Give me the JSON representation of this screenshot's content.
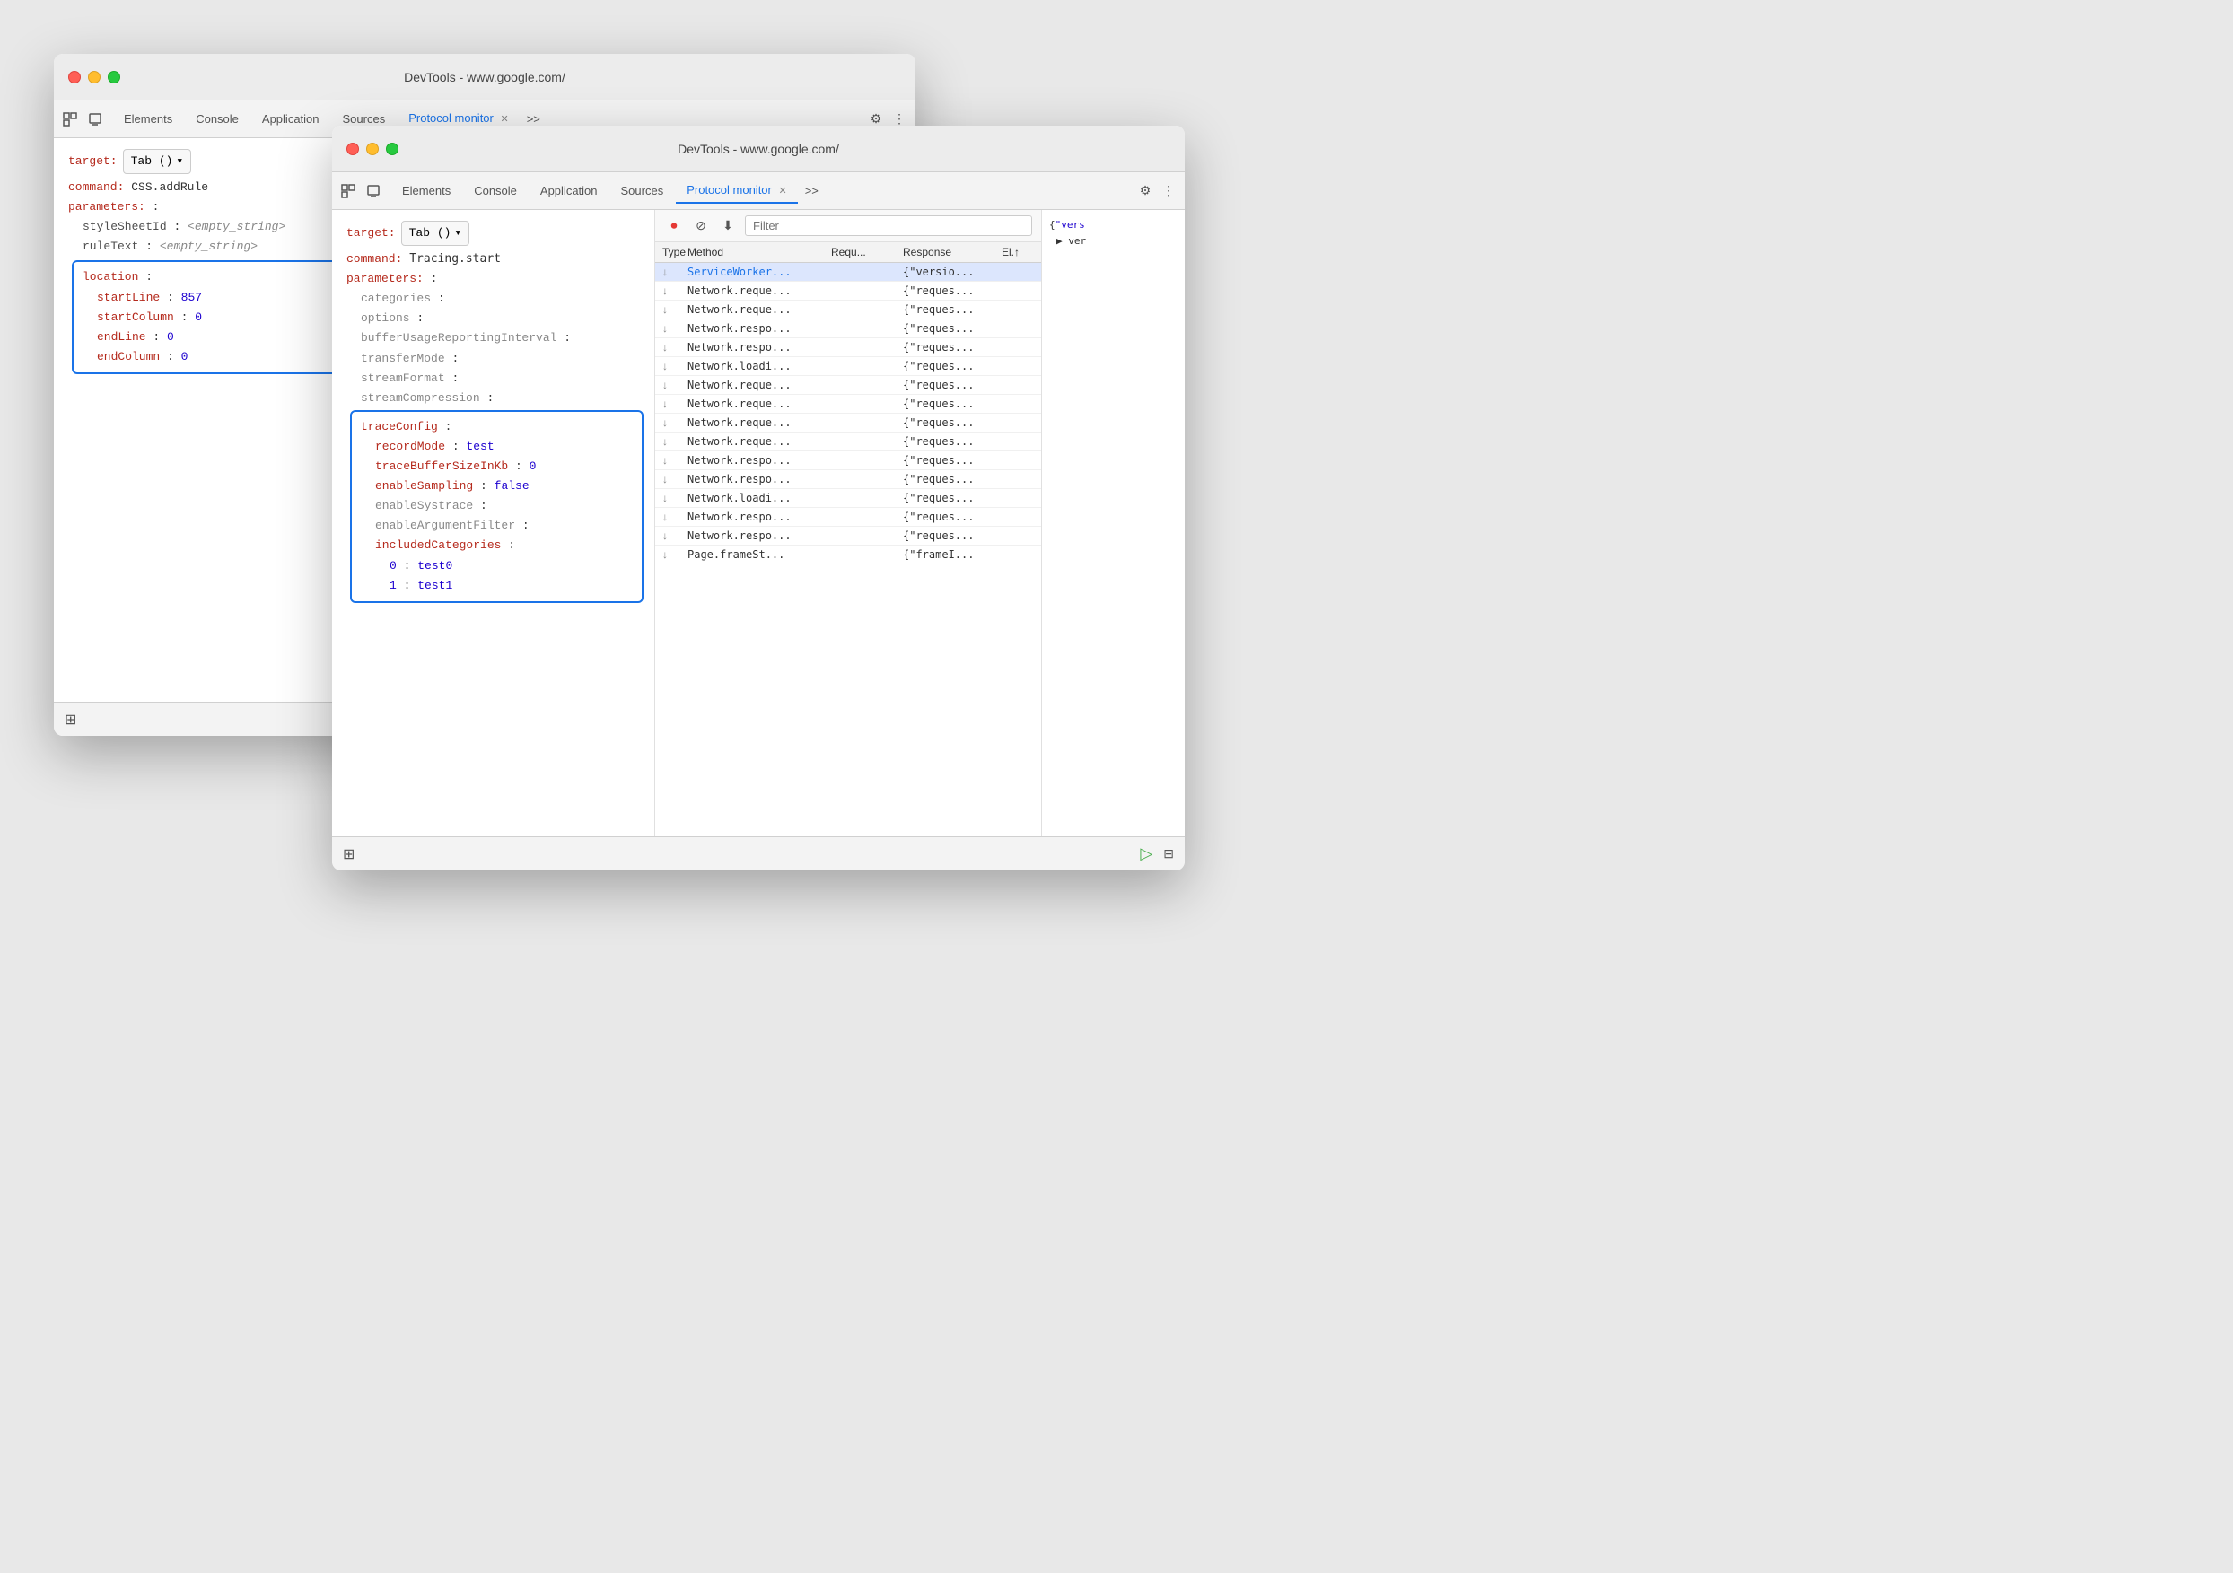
{
  "background_window": {
    "title": "DevTools - www.google.com/",
    "tabs": [
      "Elements",
      "Console",
      "Application",
      "Sources",
      "Protocol monitor"
    ],
    "active_tab": "Protocol monitor",
    "target_label": "target:",
    "target_value": "Tab ()",
    "command_label": "command:",
    "command_value": "CSS.addRule",
    "parameters_label": "parameters:",
    "params": [
      {
        "key": "styleSheetId",
        "value": "<empty_string>",
        "indent": 2
      },
      {
        "key": "ruleText",
        "value": "<empty_string>",
        "indent": 2
      }
    ],
    "location_label": "location",
    "location_params": [
      {
        "key": "startLine",
        "value": "857",
        "indent": 3
      },
      {
        "key": "startColumn",
        "value": "0",
        "indent": 3
      },
      {
        "key": "endLine",
        "value": "0",
        "indent": 3
      },
      {
        "key": "endColumn",
        "value": "0",
        "indent": 3
      }
    ]
  },
  "foreground_window": {
    "title": "DevTools - www.google.com/",
    "tabs": [
      "Elements",
      "Console",
      "Application",
      "Sources",
      "Protocol monitor"
    ],
    "active_tab": "Protocol monitor",
    "target_label": "target:",
    "target_value": "Tab ()",
    "command_label": "command:",
    "command_value": "Tracing.start",
    "parameters_label": "parameters:",
    "params_plain": [
      {
        "key": "categories",
        "indent": 2
      },
      {
        "key": "options",
        "indent": 2
      },
      {
        "key": "bufferUsageReportingInterval",
        "indent": 2
      },
      {
        "key": "transferMode",
        "indent": 2
      },
      {
        "key": "streamFormat",
        "indent": 2
      },
      {
        "key": "streamCompression",
        "indent": 2
      }
    ],
    "trace_config_label": "traceConfig",
    "trace_config_params": [
      {
        "key": "recordMode",
        "value": "test",
        "indent": 4
      },
      {
        "key": "traceBufferSizeInKb",
        "value": "0",
        "indent": 4
      },
      {
        "key": "enableSampling",
        "value": "false",
        "indent": 4
      },
      {
        "key": "enableSystrace",
        "indent": 4
      },
      {
        "key": "enableArgumentFilter",
        "indent": 4
      },
      {
        "key": "includedCategories",
        "indent": 4
      },
      {
        "key": "0",
        "value": "test0",
        "indent": 5
      },
      {
        "key": "1",
        "value": "test1",
        "indent": 5
      }
    ],
    "filter_placeholder": "Filter",
    "table_headers": [
      "Type",
      "Method",
      "Requ...",
      "Response",
      "El.↑"
    ],
    "table_rows": [
      {
        "arrow": "↓",
        "method": "ServiceWorker...",
        "request": "",
        "response": "{\"versio...",
        "selected": true
      },
      {
        "arrow": "↓",
        "method": "Network.reque...",
        "request": "",
        "response": "{\"reques..."
      },
      {
        "arrow": "↓",
        "method": "Network.reque...",
        "request": "",
        "response": "{\"reques..."
      },
      {
        "arrow": "↓",
        "method": "Network.respo...",
        "request": "",
        "response": "{\"reques..."
      },
      {
        "arrow": "↓",
        "method": "Network.respo...",
        "request": "",
        "response": "{\"reques..."
      },
      {
        "arrow": "↓",
        "method": "Network.loadi...",
        "request": "",
        "response": "{\"reques..."
      },
      {
        "arrow": "↓",
        "method": "Network.reque...",
        "request": "",
        "response": "{\"reques..."
      },
      {
        "arrow": "↓",
        "method": "Network.reque...",
        "request": "",
        "response": "{\"reques..."
      },
      {
        "arrow": "↓",
        "method": "Network.reque...",
        "request": "",
        "response": "{\"reques..."
      },
      {
        "arrow": "↓",
        "method": "Network.reque...",
        "request": "",
        "response": "{\"reques..."
      },
      {
        "arrow": "↓",
        "method": "Network.respo...",
        "request": "",
        "response": "{\"reques..."
      },
      {
        "arrow": "↓",
        "method": "Network.respo...",
        "request": "",
        "response": "{\"reques..."
      },
      {
        "arrow": "↓",
        "method": "Network.loadi...",
        "request": "",
        "response": "{\"reques..."
      },
      {
        "arrow": "↓",
        "method": "Network.respo...",
        "request": "",
        "response": "{\"reques..."
      },
      {
        "arrow": "↓",
        "method": "Network.respo...",
        "request": "",
        "response": "{\"reques..."
      },
      {
        "arrow": "↓",
        "method": "Page.frameSt...",
        "request": "",
        "response": "{\"frameI..."
      }
    ],
    "json_preview": "{\"vers\n▶ ver"
  },
  "colors": {
    "accent": "#1a73e8",
    "red_label": "#b52a1d",
    "blue_value": "#1c00cf",
    "grey_value": "#888888",
    "active_tab": "#1a73e8",
    "highlight_border": "#1a73e8"
  }
}
